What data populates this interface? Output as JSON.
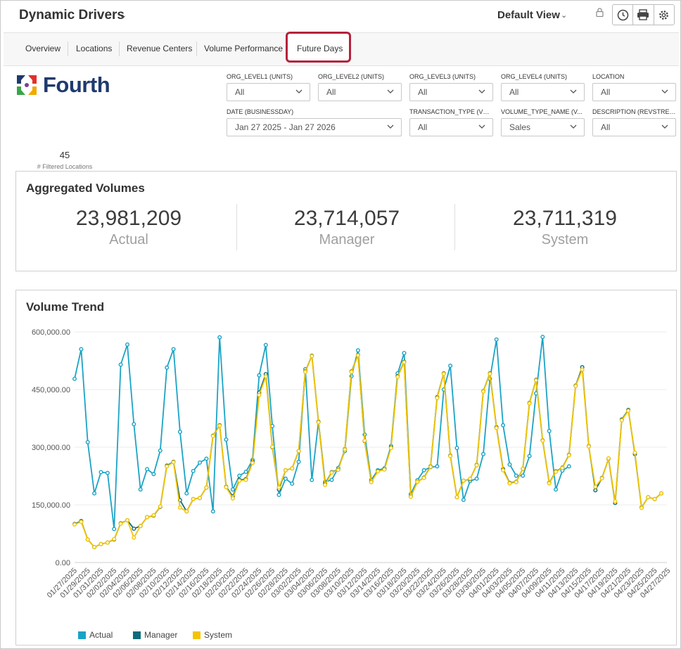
{
  "header": {
    "app_title": "Dynamic Drivers",
    "view_label": "Default View",
    "icons": [
      "lock-icon",
      "clock-icon",
      "print-icon",
      "gear-icon"
    ]
  },
  "tabs": [
    {
      "label": "Overview"
    },
    {
      "label": "Locations"
    },
    {
      "label": "Revenue Centers"
    },
    {
      "label": "Volume Performance"
    },
    {
      "label": "Future Days",
      "highlighted": true
    }
  ],
  "logo": {
    "text": "Fourth"
  },
  "filters": [
    {
      "label": "ORG_LEVEL1 (UNITS)",
      "value": "All"
    },
    {
      "label": "ORG_LEVEL2 (UNITS)",
      "value": "All"
    },
    {
      "label": "ORG_LEVEL3 (UNITS)",
      "value": "All"
    },
    {
      "label": "ORG_LEVEL4 (UNITS)",
      "value": "All"
    },
    {
      "label": "LOCATION",
      "value": "All"
    },
    {
      "label": "DATE (BUSINESSDAY)",
      "value": "Jan 27 2025 - Jan 27 2026"
    },
    {
      "label": "TRANSACTION_TYPE (VO...",
      "value": "All"
    },
    {
      "label": "VOLUME_TYPE_NAME (V...",
      "value": "Sales"
    },
    {
      "label": "DESCRIPTION (REVSTREA...",
      "value": "All"
    }
  ],
  "locations": {
    "count": "45",
    "label": "# Filtered Locations"
  },
  "aggregated": {
    "title": "Aggregated Volumes",
    "kpis": [
      {
        "value": "23,981,209",
        "label": "Actual"
      },
      {
        "value": "23,714,057",
        "label": "Manager"
      },
      {
        "value": "23,711,319",
        "label": "System"
      }
    ]
  },
  "trend": {
    "title": "Volume Trend"
  },
  "chart_data": {
    "type": "line",
    "ylim": [
      0,
      600000
    ],
    "yticks": [
      0,
      150000,
      300000,
      450000,
      600000
    ],
    "ytick_labels": [
      "0.00",
      "150,000.00",
      "300,000.00",
      "450,000.00",
      "600,000.00"
    ],
    "xtick_labels": [
      "01/27/2025",
      "01/29/2025",
      "01/31/2025",
      "02/02/2025",
      "02/04/2025",
      "02/06/2025",
      "02/08/2025",
      "02/10/2025",
      "02/12/2025",
      "02/14/2025",
      "02/16/2025",
      "02/18/2025",
      "02/20/2025",
      "02/22/2025",
      "02/24/2025",
      "02/26/2025",
      "02/28/2025",
      "03/02/2025",
      "03/04/2025",
      "03/06/2025",
      "03/08/2025",
      "03/10/2025",
      "03/12/2025",
      "03/14/2025",
      "03/16/2025",
      "03/18/2025",
      "03/20/2025",
      "03/22/2025",
      "03/24/2025",
      "03/26/2025",
      "03/28/2025",
      "03/30/2025",
      "04/01/2025",
      "04/03/2025",
      "04/05/2025",
      "04/07/2025",
      "04/09/2025",
      "04/11/2025",
      "04/13/2025",
      "04/15/2025",
      "04/17/2025",
      "04/19/2025",
      "04/21/2025",
      "04/23/2025",
      "04/25/2025",
      "04/27/2025"
    ],
    "legend_position": "bottom-left",
    "series": [
      {
        "name": "Actual",
        "color": "#1ba3c6",
        "values": [
          478000,
          555000,
          313000,
          180000,
          235000,
          233000,
          87000,
          515000,
          567000,
          360000,
          190000,
          243000,
          230000,
          291000,
          507000,
          555000,
          340000,
          180000,
          238000,
          260000,
          270000,
          133000,
          586000,
          320000,
          190000,
          226000,
          236000,
          267000,
          487000,
          566000,
          355000,
          176000,
          218000,
          205000,
          262000,
          503000,
          215000,
          366000,
          210000,
          215000,
          246000,
          290000,
          485000,
          552000,
          333000,
          215000,
          240000,
          245000,
          303000,
          492000,
          545000,
          178000,
          214000,
          240000,
          248000,
          250000,
          450000,
          512000,
          298000,
          163000,
          212000,
          218000,
          282000,
          478000,
          580000,
          357000,
          255000,
          226000,
          226000,
          277000,
          440000,
          587000,
          342000,
          190000,
          239000,
          250000,
          null,
          null,
          null,
          null,
          null,
          null,
          null,
          null,
          null,
          null,
          null,
          null,
          null,
          null,
          null,
          null,
          null
        ]
      },
      {
        "name": "Manager",
        "color": "#0f6b7a",
        "values": [
          100000,
          108000,
          60000,
          40000,
          48000,
          52000,
          60000,
          102000,
          110000,
          88000,
          95000,
          118000,
          122000,
          145000,
          252000,
          262000,
          162000,
          133000,
          165000,
          168000,
          195000,
          330000,
          357000,
          197000,
          172000,
          215000,
          217000,
          263000,
          442000,
          490000,
          300000,
          190000,
          240000,
          245000,
          290000,
          497000,
          538000,
          366000,
          205000,
          235000,
          242000,
          295000,
          497000,
          540000,
          316000,
          210000,
          238000,
          243000,
          300000,
          485000,
          522000,
          172000,
          210000,
          221000,
          250000,
          430000,
          492000,
          278000,
          170000,
          213000,
          217000,
          254000,
          446000,
          492000,
          352000,
          243000,
          207000,
          210000,
          244000,
          415000,
          475000,
          318000,
          207000,
          237000,
          247000,
          280000,
          460000,
          508000,
          303000,
          188000,
          220000,
          270000,
          155000,
          372000,
          397000,
          282000,
          143000,
          170000,
          165000,
          180000
        ]
      },
      {
        "name": "System",
        "color": "#f5c400",
        "values": [
          99000,
          106000,
          60000,
          40000,
          48000,
          52000,
          61000,
          101000,
          110000,
          65000,
          95000,
          118000,
          123000,
          146000,
          250000,
          261000,
          143000,
          133000,
          165000,
          168000,
          195000,
          329000,
          356000,
          196000,
          167000,
          213000,
          215000,
          259000,
          436000,
          484000,
          301000,
          195000,
          240000,
          245000,
          290000,
          496000,
          537000,
          365000,
          202000,
          234000,
          241000,
          294000,
          496000,
          539000,
          317000,
          209000,
          237000,
          242000,
          298000,
          483000,
          521000,
          171000,
          210000,
          220000,
          249000,
          428000,
          491000,
          277000,
          170000,
          213000,
          218000,
          253000,
          445000,
          491000,
          350000,
          240000,
          206000,
          209000,
          244000,
          414000,
          474000,
          317000,
          206000,
          236000,
          246000,
          279000,
          459000,
          502000,
          302000,
          197000,
          219000,
          271000,
          159000,
          370000,
          395000,
          286000,
          142000,
          170000,
          165000,
          180000
        ]
      }
    ]
  }
}
